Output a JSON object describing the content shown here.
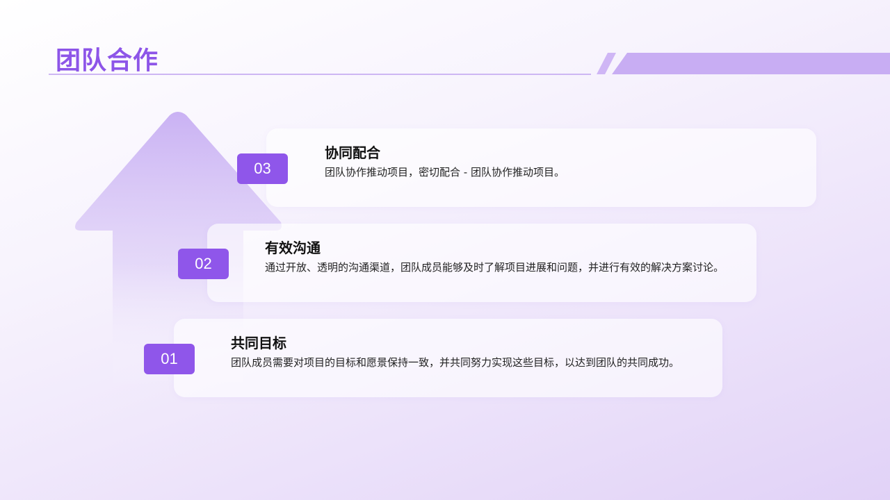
{
  "page": {
    "title": "团队合作"
  },
  "colors": {
    "accent": "#8f56ea",
    "title": "#8d55e8",
    "band": "#c8adf3"
  },
  "steps": [
    {
      "number": "03",
      "title": "协同配合",
      "description": "团队协作推动项目，密切配合 - 团队协作推动项目。"
    },
    {
      "number": "02",
      "title": "有效沟通",
      "description": "通过开放、透明的沟通渠道，团队成员能够及时了解项目进展和问题，并进行有效的解决方案讨论。"
    },
    {
      "number": "01",
      "title": "共同目标",
      "description": "团队成员需要对项目的目标和愿景保持一致，并共同努力实现这些目标，以达到团队的共同成功。"
    }
  ]
}
